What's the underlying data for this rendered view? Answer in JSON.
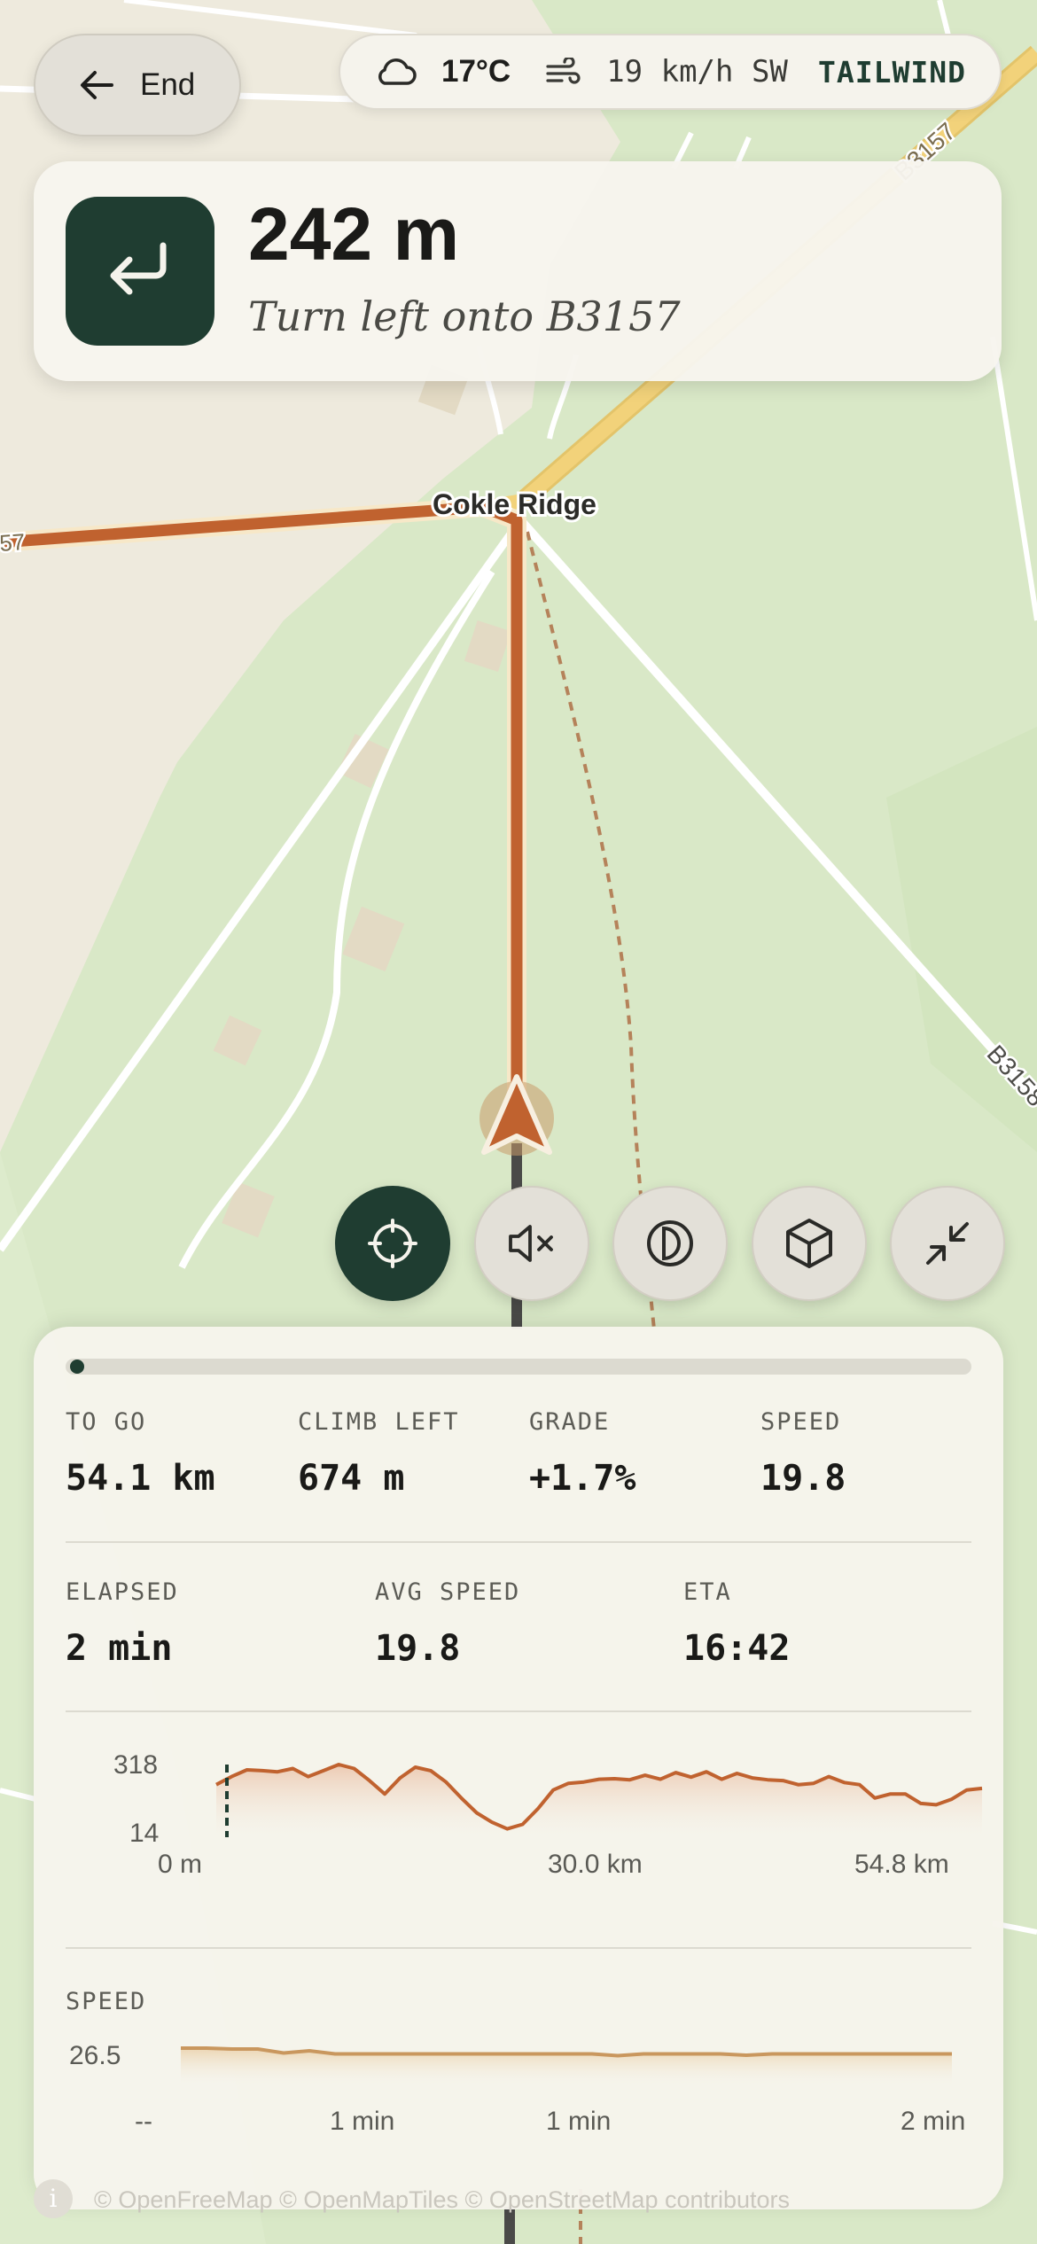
{
  "top": {
    "end_label": "End",
    "temperature": "17°C",
    "wind": "19 km/h SW",
    "wind_effect": "TAILWIND"
  },
  "instruction": {
    "distance": "242 m",
    "text": "Turn left onto B3157"
  },
  "map": {
    "place_label": "Cokle Ridge",
    "road_labels": [
      "B3157",
      "B3158",
      "57"
    ],
    "attribution": "© OpenFreeMap  © OpenMapTiles  © OpenStreetMap contributors",
    "colors": {
      "route": "#c0622f",
      "road_major": "#f2d27a",
      "forest": "#d9e8c7",
      "land": "#eeeadd"
    }
  },
  "controls": [
    "recenter",
    "mute",
    "contrast",
    "3d-view",
    "collapse"
  ],
  "stats": {
    "progress": 0.005,
    "row1": [
      {
        "label": "TO GO",
        "value": "54.1 km"
      },
      {
        "label": "CLIMB LEFT",
        "value": "674 m"
      },
      {
        "label": "GRADE",
        "value": "+1.7%"
      },
      {
        "label": "SPEED",
        "value": "19.8"
      }
    ],
    "row2": [
      {
        "label": "ELAPSED",
        "value": "2 min"
      },
      {
        "label": "AVG SPEED",
        "value": "19.8"
      },
      {
        "label": "ETA",
        "value": "16:42"
      }
    ]
  },
  "elevation": {
    "y_max": "318",
    "y_min": "14",
    "x_labels": [
      "0 m",
      "30.0 km",
      "54.8 km"
    ],
    "profile": [
      210,
      240,
      265,
      262,
      258,
      270,
      240,
      262,
      285,
      270,
      225,
      175,
      235,
      275,
      262,
      220,
      160,
      105,
      70,
      45,
      62,
      120,
      190,
      215,
      220,
      230,
      232,
      228,
      245,
      230,
      255,
      238,
      258,
      230,
      252,
      235,
      228,
      225,
      210,
      215,
      240,
      218,
      210,
      160,
      175,
      175,
      140,
      135,
      155,
      190,
      196
    ]
  },
  "speed": {
    "label": "SPEED",
    "y_max": "26.5",
    "x_labels": [
      "--",
      "1 min",
      "1 min",
      "2 min"
    ],
    "profile": [
      26.5,
      26.5,
      26.3,
      26.3,
      25.4,
      25.9,
      25.2,
      25.2,
      25.2,
      25.2,
      25.2,
      25.2,
      25.2,
      25.2,
      25.2,
      25.2,
      25.2,
      24.8,
      25.2,
      25.2,
      25.2,
      25.2,
      24.9,
      25.2,
      25.2,
      25.2,
      25.2,
      25.2,
      25.2,
      25.2,
      25.2
    ]
  }
}
